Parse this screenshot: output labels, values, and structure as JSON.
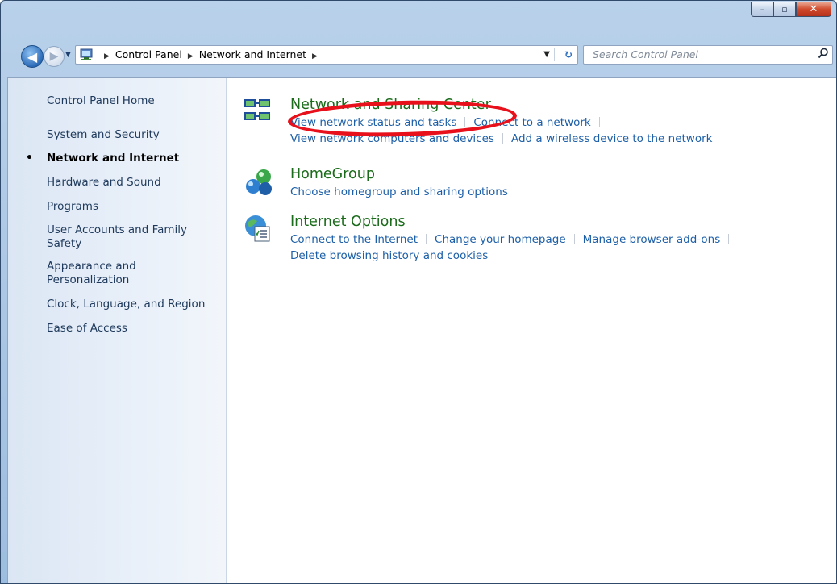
{
  "window": {
    "caption_buttons": {
      "minimize_glyph": "–",
      "maximize_glyph": "▫",
      "close_glyph": "✕"
    }
  },
  "navigation": {
    "back_glyph": "◀",
    "forward_glyph": "▶",
    "recent_glyph": "▼",
    "address_icon": "control-panel-icon",
    "breadcrumbs": [
      "Control Panel",
      "Network and Internet"
    ],
    "breadcrumb_separator": "▶",
    "dropdown_glyph": "▼",
    "refresh_glyph": "↻"
  },
  "search": {
    "placeholder": "Search Control Panel",
    "icon_glyph": "⚲"
  },
  "sidebar": {
    "bullet": "•",
    "items": [
      {
        "label": "Control Panel Home"
      },
      {
        "label": "System and Security"
      },
      {
        "label": "Network and Internet",
        "current": true
      },
      {
        "label": "Hardware and Sound"
      },
      {
        "label": "Programs"
      },
      {
        "label": "User Accounts and Family Safety"
      },
      {
        "label": "Appearance and Personalization"
      },
      {
        "label": "Clock, Language, and Region"
      },
      {
        "label": "Ease of Access"
      }
    ]
  },
  "main": {
    "categories": [
      {
        "title": "Network and Sharing Center",
        "icon": "network-sharing-icon",
        "highlighted": true,
        "links": [
          [
            "View network status and tasks",
            "Connect to a network"
          ],
          [
            "View network computers and devices",
            "Add a wireless device to the network"
          ]
        ]
      },
      {
        "title": "HomeGroup",
        "icon": "homegroup-icon",
        "links": [
          [
            "Choose homegroup and sharing options"
          ]
        ]
      },
      {
        "title": "Internet Options",
        "icon": "internet-options-icon",
        "links": [
          [
            "Connect to the Internet",
            "Change your homepage",
            "Manage browser add-ons"
          ],
          [
            "Delete browsing history and cookies"
          ]
        ]
      }
    ]
  },
  "colors": {
    "category_title": "#1a6b1a",
    "link": "#1c5fa8",
    "highlight": "#e8101a"
  }
}
